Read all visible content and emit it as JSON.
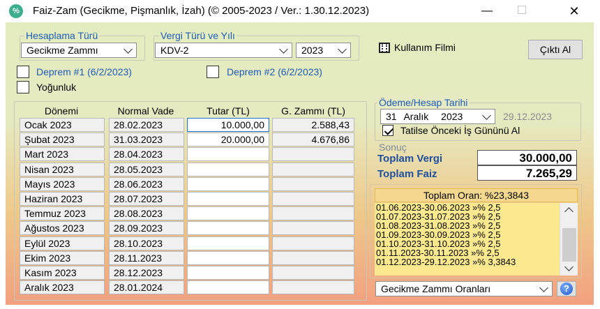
{
  "window": {
    "app_icon": "%",
    "title": "Faiz-Zam (Gecikme, Pişmanlık, İzah) (©  2005-2023 / Ver.: 1.30.12.2023)",
    "minimize_glyph": "—",
    "maximize_glyph": "☐",
    "close_glyph": "✕"
  },
  "calc_type": {
    "legend": "Hesaplama Türü",
    "value": "Gecikme Zammı"
  },
  "tax": {
    "legend": "Vergi Türü ve Yılı",
    "type_value": "KDV-2",
    "year_value": "2023"
  },
  "film_label": "Kullanım Filmi",
  "print_label": "Çıktı Al",
  "deprem1_label": "Deprem #1 (6/2/2023)",
  "deprem2_label": "Deprem #2 (6/2/2023)",
  "yogunluk_label": "Yoğunluk",
  "table": {
    "headers": [
      "Dönemi",
      "Normal Vade",
      "Tutar (TL)",
      "G. Zammı (TL)"
    ],
    "rows": [
      {
        "period": "Ocak 2023",
        "due": "28.02.2023",
        "amount": "10.000,00",
        "penalty": "2.588,43"
      },
      {
        "period": "Şubat 2023",
        "due": "31.03.2023",
        "amount": "20.000,00",
        "penalty": "4.676,86"
      },
      {
        "period": "Mart 2023",
        "due": "28.04.2023",
        "amount": "",
        "penalty": ""
      },
      {
        "period": "Nisan 2023",
        "due": "28.05.2023",
        "amount": "",
        "penalty": ""
      },
      {
        "period": "Mayıs 2023",
        "due": "28.06.2023",
        "amount": "",
        "penalty": ""
      },
      {
        "period": "Haziran 2023",
        "due": "28.07.2023",
        "amount": "",
        "penalty": ""
      },
      {
        "period": "Temmuz 2023",
        "due": "28.08.2023",
        "amount": "",
        "penalty": ""
      },
      {
        "period": "Ağustos 2023",
        "due": "28.09.2023",
        "amount": "",
        "penalty": ""
      },
      {
        "period": "Eylül 2023",
        "due": "28.10.2023",
        "amount": "",
        "penalty": ""
      },
      {
        "period": "Ekim 2023",
        "due": "28.11.2023",
        "amount": "",
        "penalty": ""
      },
      {
        "period": "Kasım 2023",
        "due": "28.12.2023",
        "amount": "",
        "penalty": ""
      },
      {
        "period": "Aralık 2023",
        "due": "28.01.2024",
        "amount": "",
        "penalty": ""
      }
    ]
  },
  "payment": {
    "legend": "Ödeme/Hesap Tarihi",
    "day": "31",
    "month": "Aralık",
    "year": "2023",
    "computed_date": "29.12.2023",
    "holiday_label": "Tatilse Önceki İş Gününü Al",
    "holiday_checked": true
  },
  "result": {
    "legend": "Sonuç",
    "total_tax_label": "Toplam Vergi",
    "total_tax_value": "30.000,00",
    "total_interest_label": "Toplam Faiz",
    "total_interest_value": "7.265,29"
  },
  "rates": {
    "title": "Toplam Oran: %23,3843",
    "lines": [
      "01.06.2023-30.06.2023 »% 2,5",
      "01.07.2023-31.07.2023 »% 2,5",
      "01.08.2023-31.08.2023 »% 2,5",
      "01.09.2023-30.09.2023 »% 2,5",
      "01.10.2023-31.10.2023 »% 2,5",
      "01.11.2023-30.11.2023 »% 2,5",
      "01.12.2023-29.12.2023 »% 3,3843"
    ],
    "dropdown_value": "Gecikme Zammı Oranları",
    "help_glyph": "?"
  },
  "colors": {
    "accent_blue": "#1e5bb8",
    "rate_panel": "#fbe88f",
    "gradient_top": "#e3ecc0",
    "gradient_bottom": "#f2a080"
  }
}
